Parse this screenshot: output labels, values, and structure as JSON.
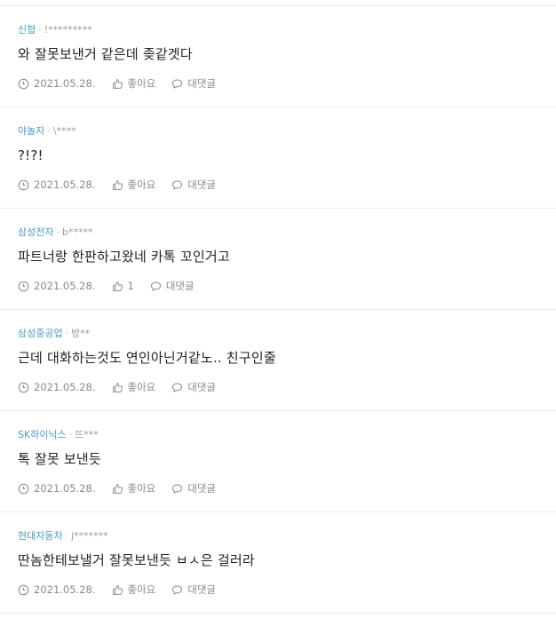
{
  "comments": [
    {
      "company": "신협",
      "user": "!*********",
      "text": "와 잘못보낸거 같은데 좆같겟다",
      "date": "2021.05.28.",
      "like_label": "좋아요",
      "reply_label": "대댓글"
    },
    {
      "company": "야놀자",
      "user": "\\****",
      "text": "?!?!",
      "date": "2021.05.28.",
      "like_label": "좋아요",
      "reply_label": "대댓글"
    },
    {
      "company": "삼성전자",
      "user": "b*****",
      "text": "파트너랑 한판하고왔네 카톡 꼬인거고",
      "date": "2021.05.28.",
      "like_label": "1",
      "reply_label": "대댓글"
    },
    {
      "company": "삼성중공업",
      "user": "방**",
      "text": "근데 대화하는것도 연인아닌거같노.. 친구인줄",
      "date": "2021.05.28.",
      "like_label": "좋아요",
      "reply_label": "대댓글"
    },
    {
      "company": "SK하이닉스",
      "user": "뜨***",
      "text": "톡 잘못 보낸듯",
      "date": "2021.05.28.",
      "like_label": "좋아요",
      "reply_label": "대댓글"
    },
    {
      "company": "현대자동차",
      "user": "j*******",
      "text": "딴놈한테보낼거 잘못보낸듯 ㅂㅅ은 걸러라",
      "date": "2021.05.28.",
      "like_label": "좋아요",
      "reply_label": "대댓글"
    }
  ],
  "separator": "·",
  "icons": {
    "date": "clock-icon",
    "like": "thumbs-up-icon",
    "reply": "speech-bubble-icon"
  },
  "colors": {
    "company": "#4a9ac4",
    "meta": "#9a9a9a",
    "divider": "#ececec"
  }
}
